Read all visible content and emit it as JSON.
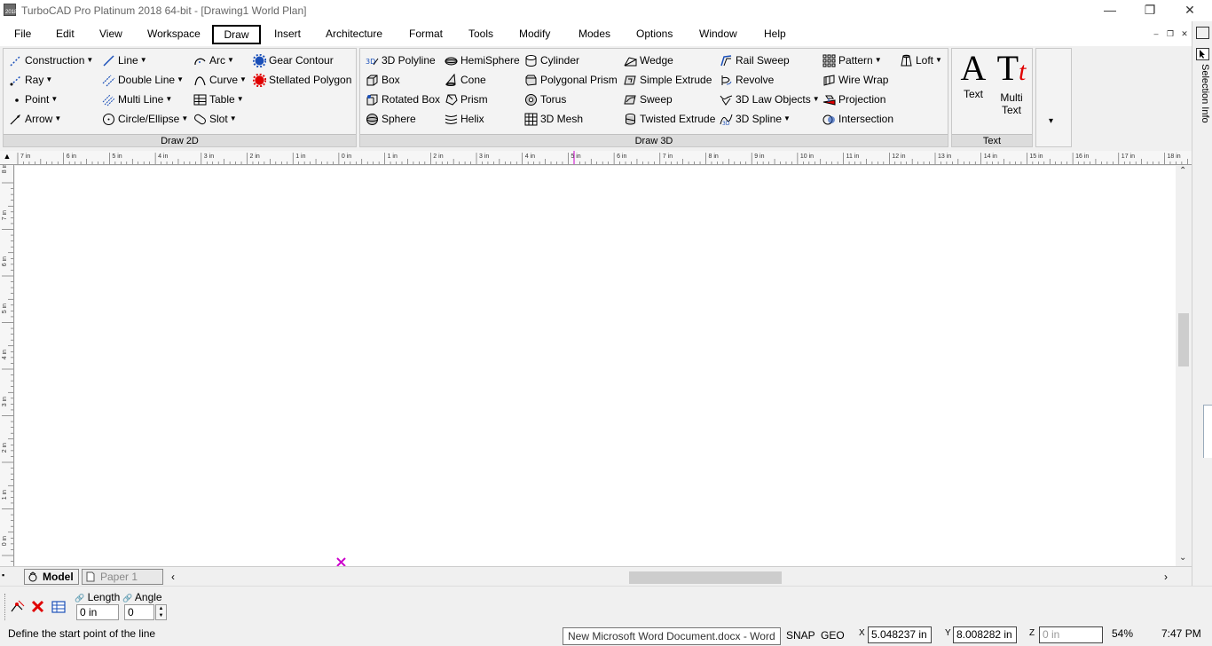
{
  "window": {
    "title": "TurboCAD Pro Platinum 2018 64-bit - [Drawing1 World Plan]",
    "icon_text": "2018",
    "minimize": "—",
    "restore": "❐",
    "close": "✕"
  },
  "menu": {
    "items": [
      "File",
      "Edit",
      "View",
      "Workspace",
      "Draw",
      "Insert",
      "Architecture",
      "Format",
      "Tools",
      "Modify",
      "Modes",
      "Options",
      "Window",
      "Help"
    ],
    "active": "Draw",
    "mdi_min": "–",
    "mdi_restore": "❐",
    "mdi_close": "✕"
  },
  "ribbon": {
    "draw2d": {
      "label": "Draw 2D",
      "col1": [
        "Construction",
        "Ray",
        "Point",
        "Arrow"
      ],
      "col2": [
        "Line",
        "Double Line",
        "Multi Line",
        "Circle/Ellipse"
      ],
      "col3": [
        "Arc",
        "Curve",
        "Table",
        "Slot"
      ],
      "col4": [
        "Gear Contour",
        "Stellated Polygon"
      ]
    },
    "draw3d": {
      "label": "Draw 3D",
      "col1": [
        "3D Polyline",
        "Box",
        "Rotated Box",
        "Sphere"
      ],
      "col2": [
        "HemiSphere",
        "Cone",
        "Prism",
        "Helix"
      ],
      "col3": [
        "Cylinder",
        "Polygonal Prism",
        "Torus",
        "3D Mesh"
      ],
      "col4": [
        "Wedge",
        "Simple Extrude",
        "Sweep",
        "Twisted Extrude"
      ],
      "col5": [
        "Rail Sweep",
        "Revolve",
        "3D Law Objects",
        "3D Spline"
      ],
      "col6": [
        "Pattern",
        "Wire Wrap",
        "Projection",
        "Intersection"
      ],
      "col7": [
        "Loft"
      ]
    },
    "text": {
      "label": "Text",
      "text_btn": "Text",
      "multi_btn_line1": "Multi",
      "multi_btn_line2": "Text",
      "text_glyph": "A",
      "multi_glyph": "T",
      "multi_glyph_accent": "t"
    },
    "overflow": "▾"
  },
  "side_panel": {
    "label": "Selection Info"
  },
  "rulers": {
    "horizontal": [
      "7 in",
      "6 in",
      "5 in",
      "4 in",
      "3 in",
      "2 in",
      "1 in",
      "0 in",
      "1 in",
      "2 in",
      "3 in",
      "4 in",
      "5 in",
      "6 in",
      "7 in",
      "8 in",
      "9 in",
      "10 in",
      "11 in",
      "12 in",
      "13 in",
      "14 in",
      "15 in",
      "16 in",
      "17 in",
      "18 in"
    ],
    "vertical": [
      "8 in",
      "7 in",
      "6 in",
      "5 in",
      "4 in",
      "3 in",
      "2 in",
      "1 in",
      "0 in"
    ]
  },
  "tabs": {
    "model": "Model",
    "paper": "Paper 1"
  },
  "inspector": {
    "length_label": "Length",
    "angle_label": "Angle",
    "length_value": "0 in",
    "angle_value": "0"
  },
  "status": {
    "message": "Define the start point of the line",
    "taskbar_tooltip": "New Microsoft Word Document.docx - Word",
    "snap": "SNAP",
    "geo": "GEO",
    "x_value": "5.048237 in",
    "y_value": "8.008282 in",
    "z_value": "0 in",
    "x_label": "X",
    "y_label": "Y",
    "z_label": "Z",
    "zoom": "54%",
    "time": "7:47 PM"
  },
  "colors": {
    "cursor_marker": "#cc00cc",
    "accent_blue": "#1a4fb8",
    "delete_red": "#e00000"
  }
}
